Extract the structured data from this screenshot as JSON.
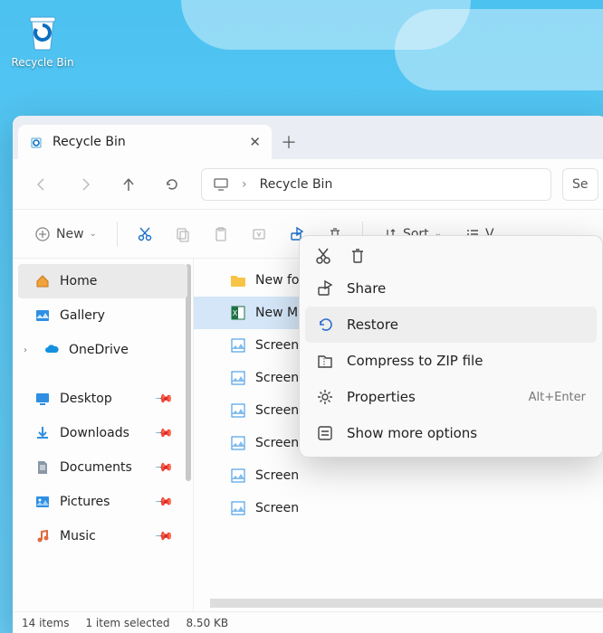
{
  "desktop": {
    "recycle_label": "Recycle Bin"
  },
  "window": {
    "tab_title": "Recycle Bin",
    "breadcrumb": "Recycle Bin",
    "search_placeholder": "Se",
    "toolbar": {
      "new": "New",
      "sort": "Sort",
      "view": "V"
    },
    "status": {
      "count": "14 items",
      "selected": "1 item selected",
      "size": "8.50 KB"
    }
  },
  "sidebar": {
    "items": [
      {
        "label": "Home"
      },
      {
        "label": "Gallery"
      },
      {
        "label": "OneDrive"
      },
      {
        "label": "Desktop"
      },
      {
        "label": "Downloads"
      },
      {
        "label": "Documents"
      },
      {
        "label": "Pictures"
      },
      {
        "label": "Music"
      }
    ]
  },
  "files": [
    {
      "name": "New folder"
    },
    {
      "name": "New Microsoft Office Excel Worksheet.xlsx"
    },
    {
      "name": "Screen"
    },
    {
      "name": "Screen"
    },
    {
      "name": "Screen"
    },
    {
      "name": "Screen"
    },
    {
      "name": "Screen"
    },
    {
      "name": "Screen"
    }
  ],
  "context_menu": {
    "share": "Share",
    "restore": "Restore",
    "compress": "Compress to ZIP file",
    "properties": "Properties",
    "properties_shortcut": "Alt+Enter",
    "more": "Show more options"
  }
}
